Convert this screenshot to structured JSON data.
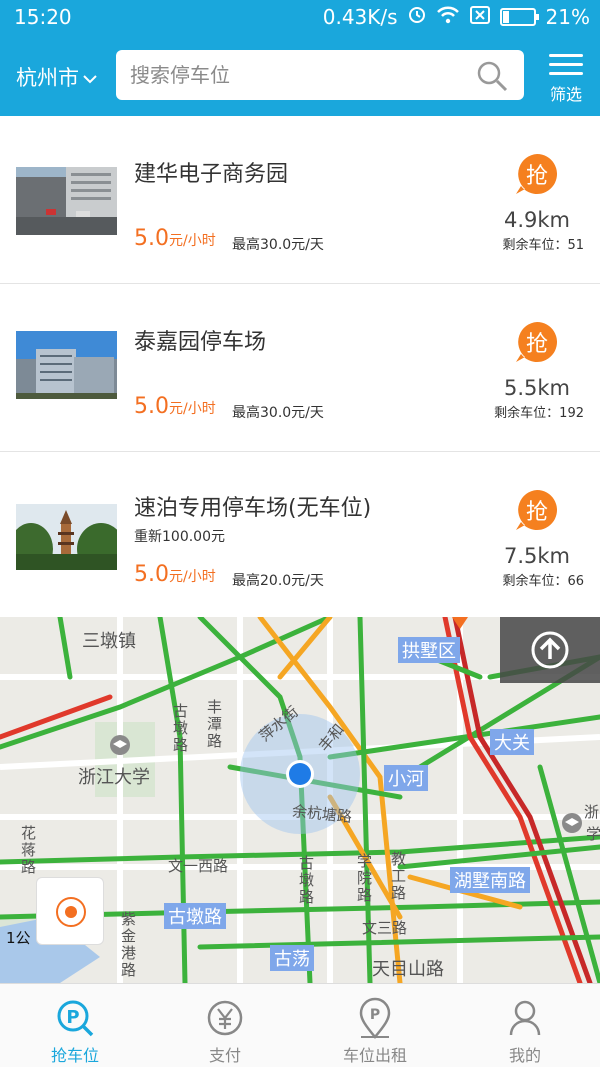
{
  "status_bar": {
    "time": "15:20",
    "network_speed": "0.43K/s",
    "battery": "21%",
    "battery_level": 0.21
  },
  "header": {
    "city": "杭州市",
    "search_placeholder": "搜索停车位",
    "filter_label": "筛选"
  },
  "parking_list": [
    {
      "name": "建华电子商务园",
      "note": "",
      "price": "5.0",
      "price_unit": "元/小时",
      "max_price": "最高30.0元/天",
      "distance": "4.9km",
      "spots_label": "剩余车位：",
      "spots": "51",
      "grab_label": "抢"
    },
    {
      "name": "泰嘉园停车场",
      "note": "",
      "price": "5.0",
      "price_unit": "元/小时",
      "max_price": "最高30.0元/天",
      "distance": "5.5km",
      "spots_label": "剩余车位：",
      "spots": "192",
      "grab_label": "抢"
    },
    {
      "name": "速泊专用停车场(无车位)",
      "note": "重新100.00元",
      "price": "5.0",
      "price_unit": "元/小时",
      "max_price": "最高20.0元/天",
      "distance": "7.5km",
      "spots_label": "剩余车位：",
      "spots": "66",
      "grab_label": "抢"
    }
  ],
  "map": {
    "labels": {
      "sandun": "三墩镇",
      "gongshu": "拱墅区",
      "daguan": "大关",
      "zju": "浙江大学",
      "xiaohe": "小河",
      "yuhangtang": "余杭塘路",
      "wenyi": "文一西路",
      "gudun": "古墩路",
      "hushu": "湖墅南路",
      "wensan": "文三路",
      "tianmushan": "天目山路",
      "gudang": "古荡",
      "fengtan": "丰潭路",
      "jiaogong": "教工路",
      "xueyuan": "学院路",
      "gudun_v": "古墩路",
      "gudun_v2": "古墩路",
      "huajiang": "花蒋路",
      "zijingang": "紫金港路",
      "pingshui": "萍水街",
      "fenghe": "丰和",
      "zhe": "浙",
      "xue": "学"
    },
    "scale_label": "1公"
  },
  "tabs": [
    {
      "label": "抢车位",
      "active": true
    },
    {
      "label": "支付",
      "active": false
    },
    {
      "label": "车位出租",
      "active": false
    },
    {
      "label": "我的",
      "active": false
    }
  ]
}
